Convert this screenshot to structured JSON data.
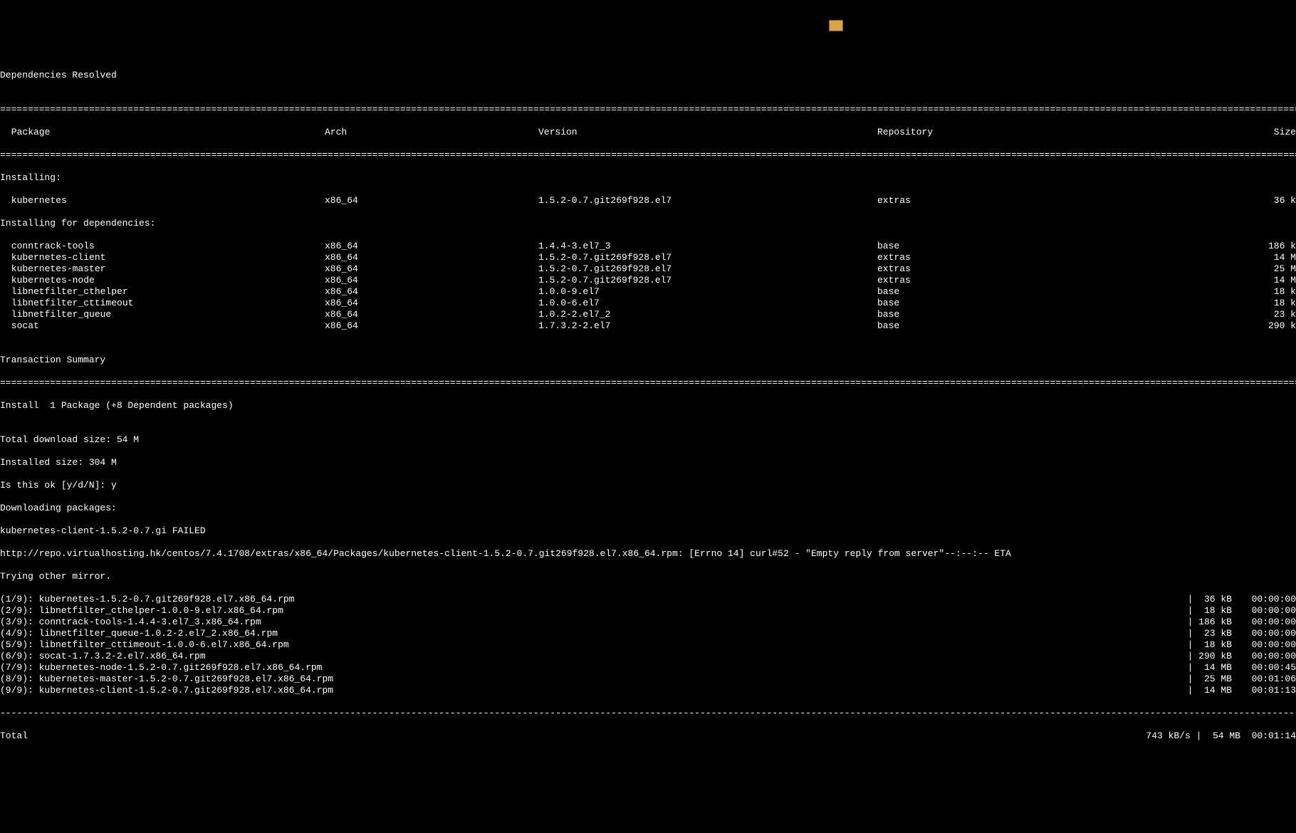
{
  "header": {
    "title": "Dependencies Resolved",
    "sep": "================================================================================================================================================================================================================================================================",
    "cols": {
      "pkg": " Package",
      "arch": "Arch",
      "ver": "Version",
      "repo": "Repository",
      "size": "Size"
    }
  },
  "sections": {
    "installing": "Installing:",
    "installing_deps": "Installing for dependencies:"
  },
  "packages": {
    "main": [
      {
        "name": " kubernetes",
        "arch": "x86_64",
        "ver": "1.5.2-0.7.git269f928.el7",
        "repo": "extras",
        "size": "36 k"
      }
    ],
    "deps": [
      {
        "name": " conntrack-tools",
        "arch": "x86_64",
        "ver": "1.4.4-3.el7_3",
        "repo": "base",
        "size": "186 k"
      },
      {
        "name": " kubernetes-client",
        "arch": "x86_64",
        "ver": "1.5.2-0.7.git269f928.el7",
        "repo": "extras",
        "size": "14 M"
      },
      {
        "name": " kubernetes-master",
        "arch": "x86_64",
        "ver": "1.5.2-0.7.git269f928.el7",
        "repo": "extras",
        "size": "25 M"
      },
      {
        "name": " kubernetes-node",
        "arch": "x86_64",
        "ver": "1.5.2-0.7.git269f928.el7",
        "repo": "extras",
        "size": "14 M"
      },
      {
        "name": " libnetfilter_cthelper",
        "arch": "x86_64",
        "ver": "1.0.0-9.el7",
        "repo": "base",
        "size": "18 k"
      },
      {
        "name": " libnetfilter_cttimeout",
        "arch": "x86_64",
        "ver": "1.0.0-6.el7",
        "repo": "base",
        "size": "18 k"
      },
      {
        "name": " libnetfilter_queue",
        "arch": "x86_64",
        "ver": "1.0.2-2.el7_2",
        "repo": "base",
        "size": "23 k"
      },
      {
        "name": " socat",
        "arch": "x86_64",
        "ver": "1.7.3.2-2.el7",
        "repo": "base",
        "size": "290 k"
      }
    ]
  },
  "summary": {
    "heading": "Transaction Summary",
    "install_line": "Install  1 Package (+8 Dependent packages)",
    "total_dl": "Total download size: 54 M",
    "installed": "Installed size: 304 M",
    "prompt": "Is this ok [y/d/N]: y",
    "downloading": "Downloading packages:",
    "failed": "kubernetes-client-1.5.2-0.7.gi FAILED",
    "err_url": "http://repo.virtualhosting.hk/centos/7.4.1708/extras/x86_64/Packages/kubernetes-client-1.5.2-0.7.git269f928.el7.x86_64.rpm: [Errno 14] curl#52 - \"Empty reply from server\"--:--:-- ETA",
    "trying": "Trying other mirror."
  },
  "downloads": [
    {
      "name": "(1/9): kubernetes-1.5.2-0.7.git269f928.el7.x86_64.rpm",
      "size": "|  36 kB",
      "time": "00:00:00"
    },
    {
      "name": "(2/9): libnetfilter_cthelper-1.0.0-9.el7.x86_64.rpm",
      "size": "|  18 kB",
      "time": "00:00:00"
    },
    {
      "name": "(3/9): conntrack-tools-1.4.4-3.el7_3.x86_64.rpm",
      "size": "| 186 kB",
      "time": "00:00:00"
    },
    {
      "name": "(4/9): libnetfilter_queue-1.0.2-2.el7_2.x86_64.rpm",
      "size": "|  23 kB",
      "time": "00:00:00"
    },
    {
      "name": "(5/9): libnetfilter_cttimeout-1.0.0-6.el7.x86_64.rpm",
      "size": "|  18 kB",
      "time": "00:00:00"
    },
    {
      "name": "(6/9): socat-1.7.3.2-2.el7.x86_64.rpm",
      "size": "| 290 kB",
      "time": "00:00:00"
    },
    {
      "name": "(7/9): kubernetes-node-1.5.2-0.7.git269f928.el7.x86_64.rpm",
      "size": "|  14 MB",
      "time": "00:00:45"
    },
    {
      "name": "(8/9): kubernetes-master-1.5.2-0.7.git269f928.el7.x86_64.rpm",
      "size": "|  25 MB",
      "time": "00:01:06"
    },
    {
      "name": "(9/9): kubernetes-client-1.5.2-0.7.git269f928.el7.x86_64.rpm",
      "size": "|  14 MB",
      "time": "00:01:13"
    }
  ],
  "dash_sep": "------------------------------------------------------------------------------------------------------------------------------------------------------------------------------------------------------------------------------------------------------------",
  "total": {
    "label": "Total",
    "speed": "743 kB/s |  54 MB  00:01:14"
  },
  "blank": ""
}
